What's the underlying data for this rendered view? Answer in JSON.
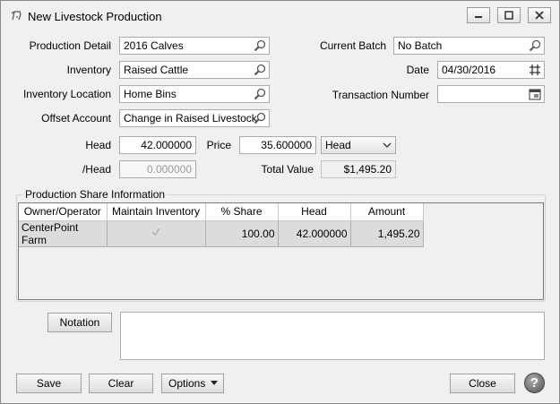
{
  "window": {
    "title": "New Livestock Production"
  },
  "form": {
    "production_detail_label": "Production Detail",
    "production_detail_value": "2016 Calves",
    "inventory_label": "Inventory",
    "inventory_value": "Raised Cattle",
    "inventory_location_label": "Inventory Location",
    "inventory_location_value": "Home Bins",
    "offset_account_label": "Offset Account",
    "offset_account_value": "Change in Raised Livestock",
    "current_batch_label": "Current Batch",
    "current_batch_value": "No Batch",
    "date_label": "Date",
    "date_value": "04/30/2016",
    "transaction_number_label": "Transaction Number",
    "transaction_number_value": "",
    "head_label": "Head",
    "head_value": "42.000000",
    "price_label": "Price",
    "price_value": "35.600000",
    "price_unit_value": "Head",
    "per_head_label": "/Head",
    "per_head_value": "0.000000",
    "total_value_label": "Total Value",
    "total_value_value": "$1,495.20"
  },
  "share": {
    "group_title": "Production Share Information",
    "columns": [
      "Owner/Operator",
      "Maintain Inventory",
      "% Share",
      "Head",
      "Amount"
    ],
    "rows": [
      {
        "owner": "CenterPoint Farm",
        "maintain_inventory": true,
        "share": "100.00",
        "head": "42.000000",
        "amount": "1,495.20"
      }
    ]
  },
  "notation": {
    "button_label": "Notation",
    "text": ""
  },
  "footer": {
    "save": "Save",
    "clear": "Clear",
    "options": "Options",
    "close": "Close",
    "help": "?"
  },
  "icons": {
    "app": "livestock-icon",
    "lookup": "magnifier-icon",
    "calendar": "calendar-icon",
    "dropdown": "chevron-down-icon"
  }
}
